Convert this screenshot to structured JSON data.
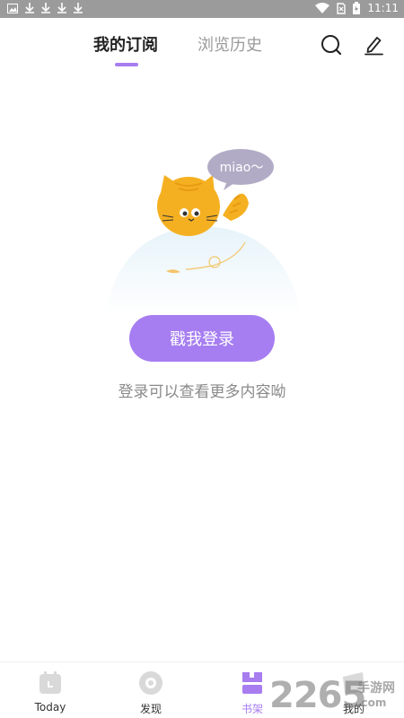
{
  "status_bar": {
    "time": "11:11"
  },
  "header": {
    "tabs": [
      {
        "label": "我的订阅",
        "active": true
      },
      {
        "label": "浏览历史",
        "active": false
      }
    ]
  },
  "empty_state": {
    "bubble_text": "miao～",
    "login_button": "戳我登录",
    "hint": "登录可以查看更多内容呦"
  },
  "bottom_nav": {
    "items": [
      {
        "label": "Today",
        "icon": "calendar-icon"
      },
      {
        "label": "发现",
        "icon": "discover-icon"
      },
      {
        "label": "书架",
        "icon": "bookshelf-icon",
        "active": true
      },
      {
        "label": "我的",
        "icon": "profile-icon"
      }
    ]
  },
  "watermark": {
    "number": "2265",
    "suffix": "手游网",
    "domain": ".com"
  },
  "colors": {
    "accent": "#a77df0",
    "button": "#a67ef1",
    "cat": "#f5b021"
  }
}
